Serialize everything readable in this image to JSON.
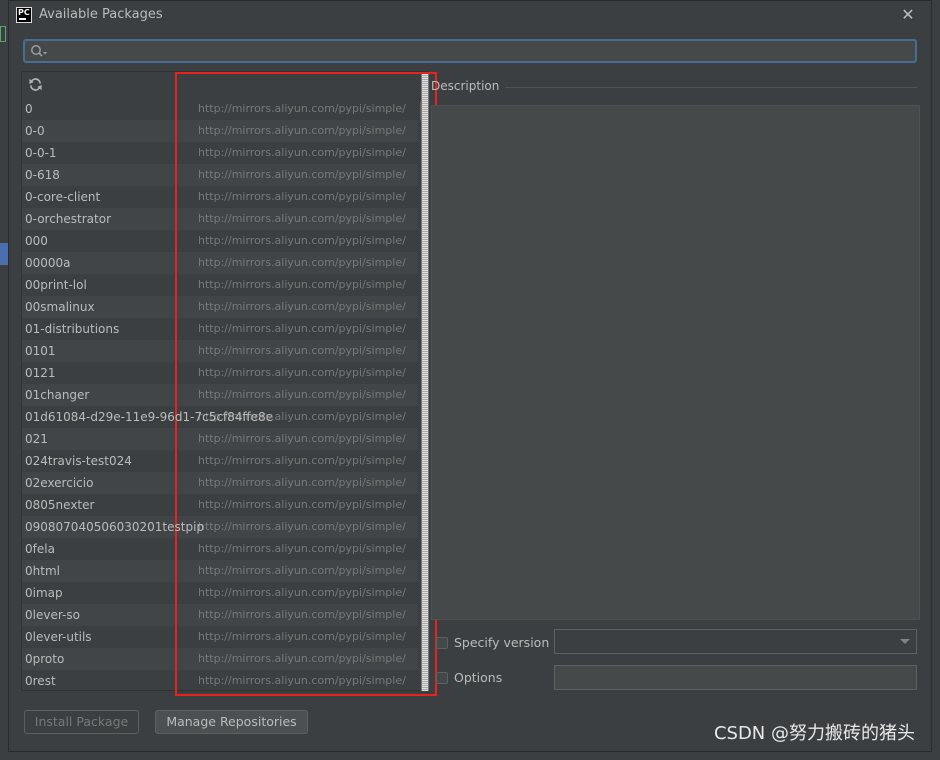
{
  "window": {
    "title": "Available Packages",
    "app_icon_text": "PC",
    "close_glyph": "✕"
  },
  "search": {
    "value": "",
    "placeholder": ""
  },
  "packages": [
    {
      "name": "0",
      "repo": "http://mirrors.aliyun.com/pypi/simple/"
    },
    {
      "name": "0-0",
      "repo": "http://mirrors.aliyun.com/pypi/simple/"
    },
    {
      "name": "0-0-1",
      "repo": "http://mirrors.aliyun.com/pypi/simple/"
    },
    {
      "name": "0-618",
      "repo": "http://mirrors.aliyun.com/pypi/simple/"
    },
    {
      "name": "0-core-client",
      "repo": "http://mirrors.aliyun.com/pypi/simple/"
    },
    {
      "name": "0-orchestrator",
      "repo": "http://mirrors.aliyun.com/pypi/simple/"
    },
    {
      "name": "000",
      "repo": "http://mirrors.aliyun.com/pypi/simple/"
    },
    {
      "name": "00000a",
      "repo": "http://mirrors.aliyun.com/pypi/simple/"
    },
    {
      "name": "00print-lol",
      "repo": "http://mirrors.aliyun.com/pypi/simple/"
    },
    {
      "name": "00smalinux",
      "repo": "http://mirrors.aliyun.com/pypi/simple/"
    },
    {
      "name": "01-distributions",
      "repo": "http://mirrors.aliyun.com/pypi/simple/"
    },
    {
      "name": "0101",
      "repo": "http://mirrors.aliyun.com/pypi/simple/"
    },
    {
      "name": "0121",
      "repo": "http://mirrors.aliyun.com/pypi/simple/"
    },
    {
      "name": "01changer",
      "repo": "http://mirrors.aliyun.com/pypi/simple/"
    },
    {
      "name": "01d61084-d29e-11e9-96d1-7c5cf84ffe8e",
      "repo": "http://mirrors.aliyun.com/pypi/simple/"
    },
    {
      "name": "021",
      "repo": "http://mirrors.aliyun.com/pypi/simple/"
    },
    {
      "name": "024travis-test024",
      "repo": "http://mirrors.aliyun.com/pypi/simple/"
    },
    {
      "name": "02exercicio",
      "repo": "http://mirrors.aliyun.com/pypi/simple/"
    },
    {
      "name": "0805nexter",
      "repo": "http://mirrors.aliyun.com/pypi/simple/"
    },
    {
      "name": "090807040506030201testpip",
      "repo": "http://mirrors.aliyun.com/pypi/simple/"
    },
    {
      "name": "0fela",
      "repo": "http://mirrors.aliyun.com/pypi/simple/"
    },
    {
      "name": "0html",
      "repo": "http://mirrors.aliyun.com/pypi/simple/"
    },
    {
      "name": "0imap",
      "repo": "http://mirrors.aliyun.com/pypi/simple/"
    },
    {
      "name": "0lever-so",
      "repo": "http://mirrors.aliyun.com/pypi/simple/"
    },
    {
      "name": "0lever-utils",
      "repo": "http://mirrors.aliyun.com/pypi/simple/"
    },
    {
      "name": "0proto",
      "repo": "http://mirrors.aliyun.com/pypi/simple/"
    },
    {
      "name": "0rest",
      "repo": "http://mirrors.aliyun.com/pypi/simple/"
    }
  ],
  "description": {
    "label": "Description",
    "text": ""
  },
  "options": {
    "specify_version_label": "Specify version",
    "specify_version_checked": false,
    "version_value": "",
    "options_label": "Options",
    "options_checked": false,
    "options_value": ""
  },
  "buttons": {
    "install": "Install Package",
    "manage": "Manage Repositories"
  },
  "watermark": "CSDN @努力搬砖的猪头",
  "colors": {
    "highlight_box": "#e8221c",
    "focus_border": "#466d94"
  }
}
